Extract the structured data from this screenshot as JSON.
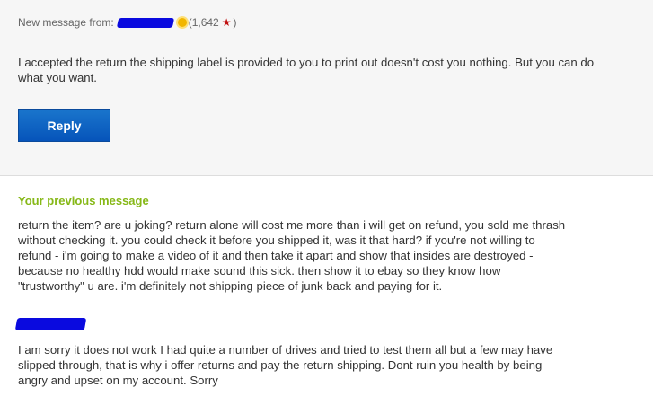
{
  "message": {
    "from_label": "New message from:",
    "feedback_open": "(1,642",
    "feedback_close": ")",
    "star_symbol": "★",
    "body": "I accepted the return the shipping label is provided to you to print out doesn't cost you nothing. But you can do what you want.",
    "reply_label": "Reply"
  },
  "previous": {
    "heading": "Your previous message",
    "body": "return the item? are u joking? return alone will cost me more than i will get on refund, you sold me thrash without checking it. you could check it before you shipped it, was it that hard? if you're not willing to refund - i'm going to make a video of it and then take it apart and show that insides are destroyed - because no healthy hdd would make sound this sick. then show it to ebay so they know how \"trustworthy\" u are. i'm definitely not shipping piece of junk back and paying for it."
  },
  "seller_reply": {
    "body": "I am sorry it does not work I had quite a number of drives and tried to test them all but a few may have slipped through, that is why i offer returns and pay the return shipping. Dont ruin you health by being angry and upset on my account. Sorry"
  },
  "colors": {
    "accent_green": "#86b817",
    "button_blue": "#0654ba",
    "redaction_blue": "#0a0adf",
    "star_red": "#c01010"
  }
}
